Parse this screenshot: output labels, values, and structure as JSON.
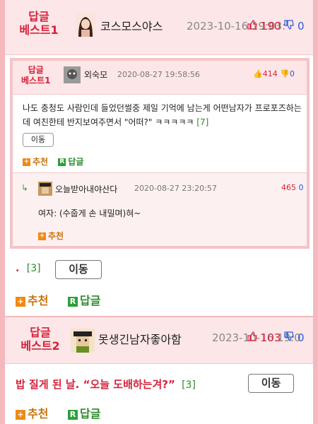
{
  "reply1": {
    "badge_line1": "답글",
    "badge_line2": "베스트1",
    "nickname": "코스모스야스",
    "date": "2023-10-16 19:03:",
    "up_count": "190",
    "down_count": "0",
    "embedded": {
      "badge_line1": "답글",
      "badge_line2": "베스트1",
      "nickname": "외숙모",
      "date": "2020-08-27 19:58:56",
      "up_count": "414",
      "down_count": "0",
      "text": "나도 충청도 사람인데 들었던썰중 제일 기억에 남는게 어떤남자가 프로포즈하는데 여친한테 반지보여주면서 \"어떠?\" ㅋㅋㅋㅋㅋ",
      "count": "[7]",
      "move_label": "이동",
      "recommend_label": "추천",
      "reply_label": "답글",
      "sub_reply": {
        "arrow": "↳",
        "nickname": "오늘받아내야산다",
        "date": "2020-08-27 23:20:57",
        "up_count": "465",
        "down_count": "0",
        "text": "여자: (수줍게 손 내밀며)혀~",
        "recommend_label": "추천"
      }
    },
    "text": ".",
    "count": "[3]",
    "move_label": "이동",
    "recommend_label": "추천",
    "reply_label": "답글"
  },
  "reply2": {
    "badge_line1": "답글",
    "badge_line2": "베스트2",
    "nickname": "못생긴남자좋아함",
    "date": "2023-10-16 19:0",
    "up_count": "103",
    "down_count": "0",
    "text": "밥 질게 된 날. “오늘 도배하는겨?”",
    "count": "[3]",
    "move_label": "이동",
    "recommend_label": "추천",
    "reply_label": "답글"
  },
  "icons": {
    "plus": "+",
    "reply": "R",
    "thumb_up": "👍",
    "thumb_down": "👎"
  },
  "colors": {
    "accent_red": "#d4223a",
    "border_pink": "#f4b8bd",
    "header_bg": "#fde6e8",
    "green": "#2e8b2e",
    "orange": "#c8730e",
    "blue": "#2a5bd7"
  }
}
